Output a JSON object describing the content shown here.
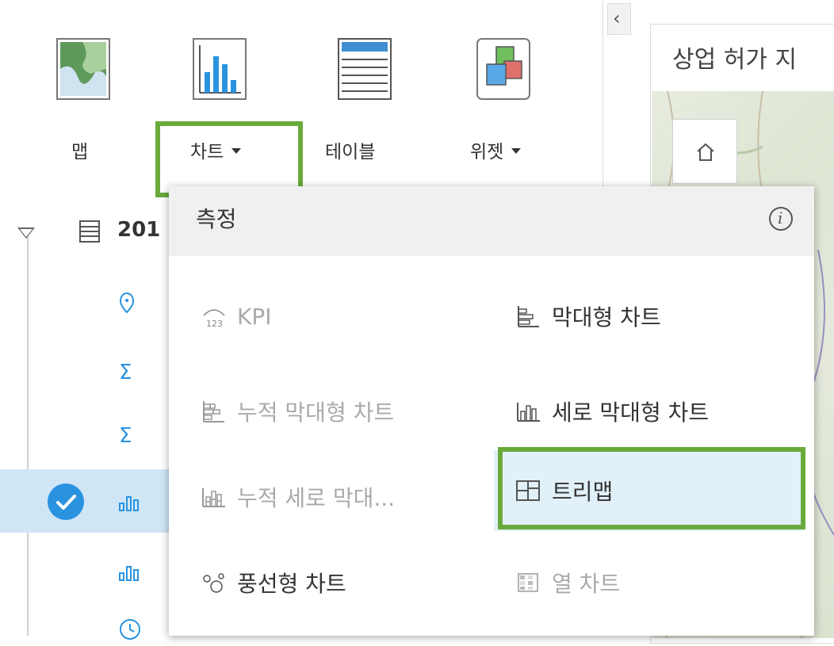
{
  "toolbar": {
    "map_label": "맵",
    "chart_label": "차트",
    "table_label": "테이블",
    "widget_label": "위젯"
  },
  "tree": {
    "title": "201"
  },
  "map_panel": {
    "title": "상업 허가 지"
  },
  "dropdown": {
    "header": "측정",
    "items": {
      "kpi": "KPI",
      "bar_chart": "막대형 차트",
      "stacked_bar_chart": "누적 막대형 차트",
      "column_chart": "세로 막대형 차트",
      "stacked_column_chart": "누적 세로 막대...",
      "treemap": "트리맵",
      "bubble_chart": "풍선형 차트",
      "heat_chart": "열 차트"
    }
  },
  "colors": {
    "highlight_green": "#6aaa3c",
    "accent_blue": "#2a93e0",
    "selected_row": "#cfe6f7"
  }
}
